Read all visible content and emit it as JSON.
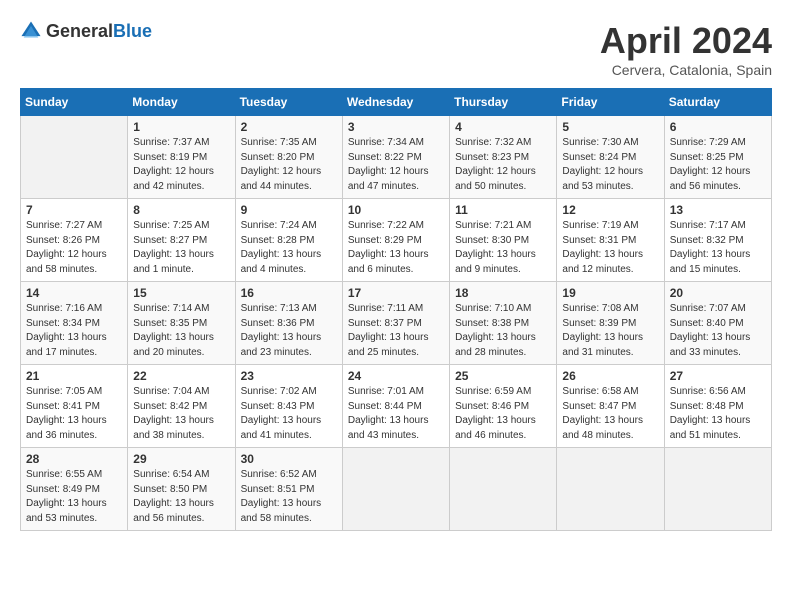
{
  "header": {
    "logo_general": "General",
    "logo_blue": "Blue",
    "title": "April 2024",
    "location": "Cervera, Catalonia, Spain"
  },
  "columns": [
    "Sunday",
    "Monday",
    "Tuesday",
    "Wednesday",
    "Thursday",
    "Friday",
    "Saturday"
  ],
  "weeks": [
    [
      {
        "day": "",
        "detail": ""
      },
      {
        "day": "1",
        "detail": "Sunrise: 7:37 AM\nSunset: 8:19 PM\nDaylight: 12 hours\nand 42 minutes."
      },
      {
        "day": "2",
        "detail": "Sunrise: 7:35 AM\nSunset: 8:20 PM\nDaylight: 12 hours\nand 44 minutes."
      },
      {
        "day": "3",
        "detail": "Sunrise: 7:34 AM\nSunset: 8:22 PM\nDaylight: 12 hours\nand 47 minutes."
      },
      {
        "day": "4",
        "detail": "Sunrise: 7:32 AM\nSunset: 8:23 PM\nDaylight: 12 hours\nand 50 minutes."
      },
      {
        "day": "5",
        "detail": "Sunrise: 7:30 AM\nSunset: 8:24 PM\nDaylight: 12 hours\nand 53 minutes."
      },
      {
        "day": "6",
        "detail": "Sunrise: 7:29 AM\nSunset: 8:25 PM\nDaylight: 12 hours\nand 56 minutes."
      }
    ],
    [
      {
        "day": "7",
        "detail": "Sunrise: 7:27 AM\nSunset: 8:26 PM\nDaylight: 12 hours\nand 58 minutes."
      },
      {
        "day": "8",
        "detail": "Sunrise: 7:25 AM\nSunset: 8:27 PM\nDaylight: 13 hours\nand 1 minute."
      },
      {
        "day": "9",
        "detail": "Sunrise: 7:24 AM\nSunset: 8:28 PM\nDaylight: 13 hours\nand 4 minutes."
      },
      {
        "day": "10",
        "detail": "Sunrise: 7:22 AM\nSunset: 8:29 PM\nDaylight: 13 hours\nand 6 minutes."
      },
      {
        "day": "11",
        "detail": "Sunrise: 7:21 AM\nSunset: 8:30 PM\nDaylight: 13 hours\nand 9 minutes."
      },
      {
        "day": "12",
        "detail": "Sunrise: 7:19 AM\nSunset: 8:31 PM\nDaylight: 13 hours\nand 12 minutes."
      },
      {
        "day": "13",
        "detail": "Sunrise: 7:17 AM\nSunset: 8:32 PM\nDaylight: 13 hours\nand 15 minutes."
      }
    ],
    [
      {
        "day": "14",
        "detail": "Sunrise: 7:16 AM\nSunset: 8:34 PM\nDaylight: 13 hours\nand 17 minutes."
      },
      {
        "day": "15",
        "detail": "Sunrise: 7:14 AM\nSunset: 8:35 PM\nDaylight: 13 hours\nand 20 minutes."
      },
      {
        "day": "16",
        "detail": "Sunrise: 7:13 AM\nSunset: 8:36 PM\nDaylight: 13 hours\nand 23 minutes."
      },
      {
        "day": "17",
        "detail": "Sunrise: 7:11 AM\nSunset: 8:37 PM\nDaylight: 13 hours\nand 25 minutes."
      },
      {
        "day": "18",
        "detail": "Sunrise: 7:10 AM\nSunset: 8:38 PM\nDaylight: 13 hours\nand 28 minutes."
      },
      {
        "day": "19",
        "detail": "Sunrise: 7:08 AM\nSunset: 8:39 PM\nDaylight: 13 hours\nand 31 minutes."
      },
      {
        "day": "20",
        "detail": "Sunrise: 7:07 AM\nSunset: 8:40 PM\nDaylight: 13 hours\nand 33 minutes."
      }
    ],
    [
      {
        "day": "21",
        "detail": "Sunrise: 7:05 AM\nSunset: 8:41 PM\nDaylight: 13 hours\nand 36 minutes."
      },
      {
        "day": "22",
        "detail": "Sunrise: 7:04 AM\nSunset: 8:42 PM\nDaylight: 13 hours\nand 38 minutes."
      },
      {
        "day": "23",
        "detail": "Sunrise: 7:02 AM\nSunset: 8:43 PM\nDaylight: 13 hours\nand 41 minutes."
      },
      {
        "day": "24",
        "detail": "Sunrise: 7:01 AM\nSunset: 8:44 PM\nDaylight: 13 hours\nand 43 minutes."
      },
      {
        "day": "25",
        "detail": "Sunrise: 6:59 AM\nSunset: 8:46 PM\nDaylight: 13 hours\nand 46 minutes."
      },
      {
        "day": "26",
        "detail": "Sunrise: 6:58 AM\nSunset: 8:47 PM\nDaylight: 13 hours\nand 48 minutes."
      },
      {
        "day": "27",
        "detail": "Sunrise: 6:56 AM\nSunset: 8:48 PM\nDaylight: 13 hours\nand 51 minutes."
      }
    ],
    [
      {
        "day": "28",
        "detail": "Sunrise: 6:55 AM\nSunset: 8:49 PM\nDaylight: 13 hours\nand 53 minutes."
      },
      {
        "day": "29",
        "detail": "Sunrise: 6:54 AM\nSunset: 8:50 PM\nDaylight: 13 hours\nand 56 minutes."
      },
      {
        "day": "30",
        "detail": "Sunrise: 6:52 AM\nSunset: 8:51 PM\nDaylight: 13 hours\nand 58 minutes."
      },
      {
        "day": "",
        "detail": ""
      },
      {
        "day": "",
        "detail": ""
      },
      {
        "day": "",
        "detail": ""
      },
      {
        "day": "",
        "detail": ""
      }
    ]
  ]
}
